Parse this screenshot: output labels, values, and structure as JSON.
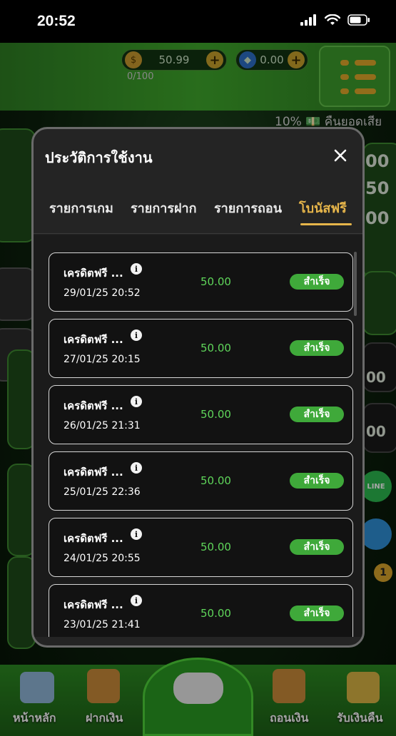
{
  "status_bar": {
    "time": "20:52"
  },
  "background": {
    "wallet_credit": "50.99",
    "wallet_points": "0.00",
    "counter": "0/100",
    "marquee": "10% 💵 คืนยอดเสีย",
    "side_values": [
      "00",
      "50",
      "00"
    ],
    "side_values_lower": [
      "00",
      "00"
    ],
    "badge_count": "1",
    "line_label": "LINE"
  },
  "bottom_nav": {
    "home": "หน้าหลัก",
    "deposit": "ฝากเงิน",
    "withdraw": "ถอนเงิน",
    "cashback": "รับเงินคืน"
  },
  "modal": {
    "title": "ประวัติการใช้งาน",
    "tabs": [
      {
        "label": "รายการเกม",
        "active": false
      },
      {
        "label": "รายการฝาก",
        "active": false
      },
      {
        "label": "รายการถอน",
        "active": false
      },
      {
        "label": "โบนัสฟรี",
        "active": true
      }
    ],
    "rows": [
      {
        "name": "เครดิตฟรี ...",
        "date": "29/01/25 20:52",
        "amount": "50.00",
        "status": "สำเร็จ"
      },
      {
        "name": "เครดิตฟรี ...",
        "date": "27/01/25 20:15",
        "amount": "50.00",
        "status": "สำเร็จ"
      },
      {
        "name": "เครดิตฟรี ...",
        "date": "26/01/25 21:31",
        "amount": "50.00",
        "status": "สำเร็จ"
      },
      {
        "name": "เครดิตฟรี ...",
        "date": "25/01/25 22:36",
        "amount": "50.00",
        "status": "สำเร็จ"
      },
      {
        "name": "เครดิตฟรี ...",
        "date": "24/01/25 20:55",
        "amount": "50.00",
        "status": "สำเร็จ"
      },
      {
        "name": "เครดิตฟรี ...",
        "date": "23/01/25 21:41",
        "amount": "50.00",
        "status": "สำเร็จ"
      }
    ]
  },
  "colors": {
    "accent_gold": "#e6b54a",
    "success_green": "#3fa93a",
    "amount_green": "#5fd65a",
    "brand_green": "#3fa82b"
  },
  "icons": {
    "close": "close-icon",
    "info": "info-icon",
    "signal": "signal-icon",
    "wifi": "wifi-icon",
    "battery": "battery-icon",
    "menu": "hamburger-menu-icon",
    "coin": "coin-icon",
    "gem": "gem-icon"
  }
}
